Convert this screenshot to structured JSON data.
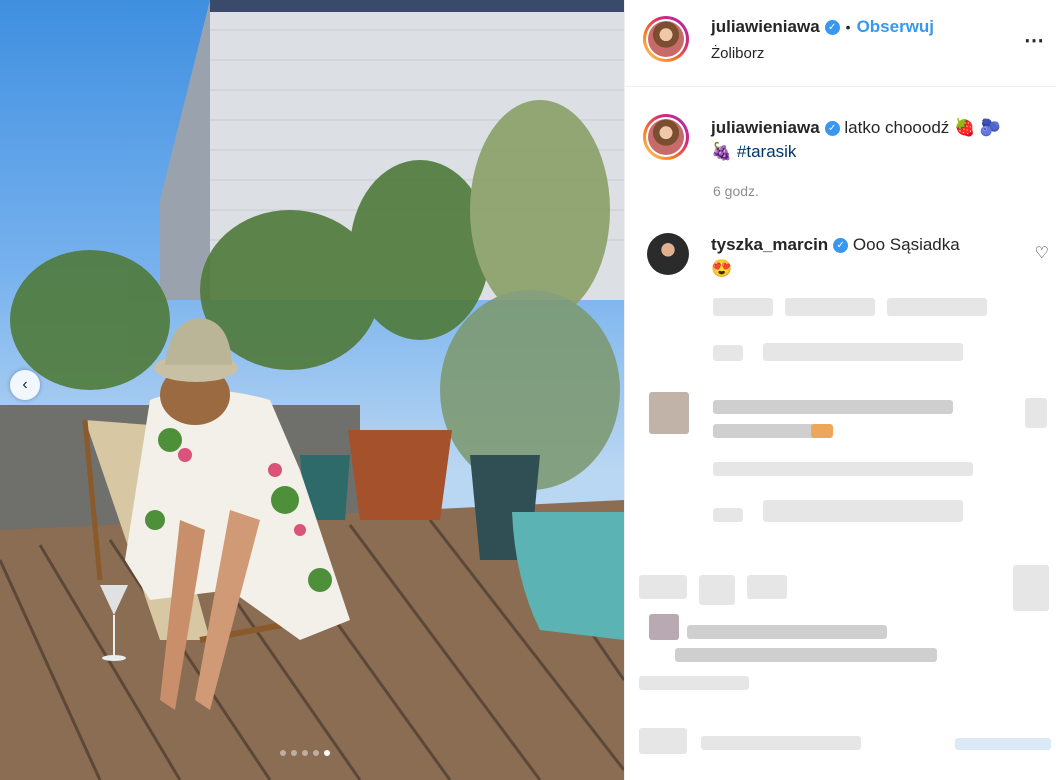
{
  "post": {
    "username": "juliawieniawa",
    "follow_label": "Obserwuj",
    "separator": "•",
    "location": "Żoliborz",
    "more_icon": "⋯",
    "verified_icon": "✓"
  },
  "caption": {
    "username": "juliawieniawa",
    "text": "latko chooodź 🍓 🫐",
    "emoji": "🍇",
    "hashtag": "#tarasik",
    "time": "6 godz."
  },
  "comments": [
    {
      "username": "tyszka_marcin",
      "text": "Ooo Sąsiadka",
      "emoji": "😍"
    }
  ],
  "carousel": {
    "count": 5,
    "active_index": 4
  },
  "icons": {
    "prev": "‹",
    "heart": "♡"
  },
  "colors": {
    "accent": "#3897f0",
    "hashtag": "#00376b",
    "muted": "#8e8e8e"
  }
}
